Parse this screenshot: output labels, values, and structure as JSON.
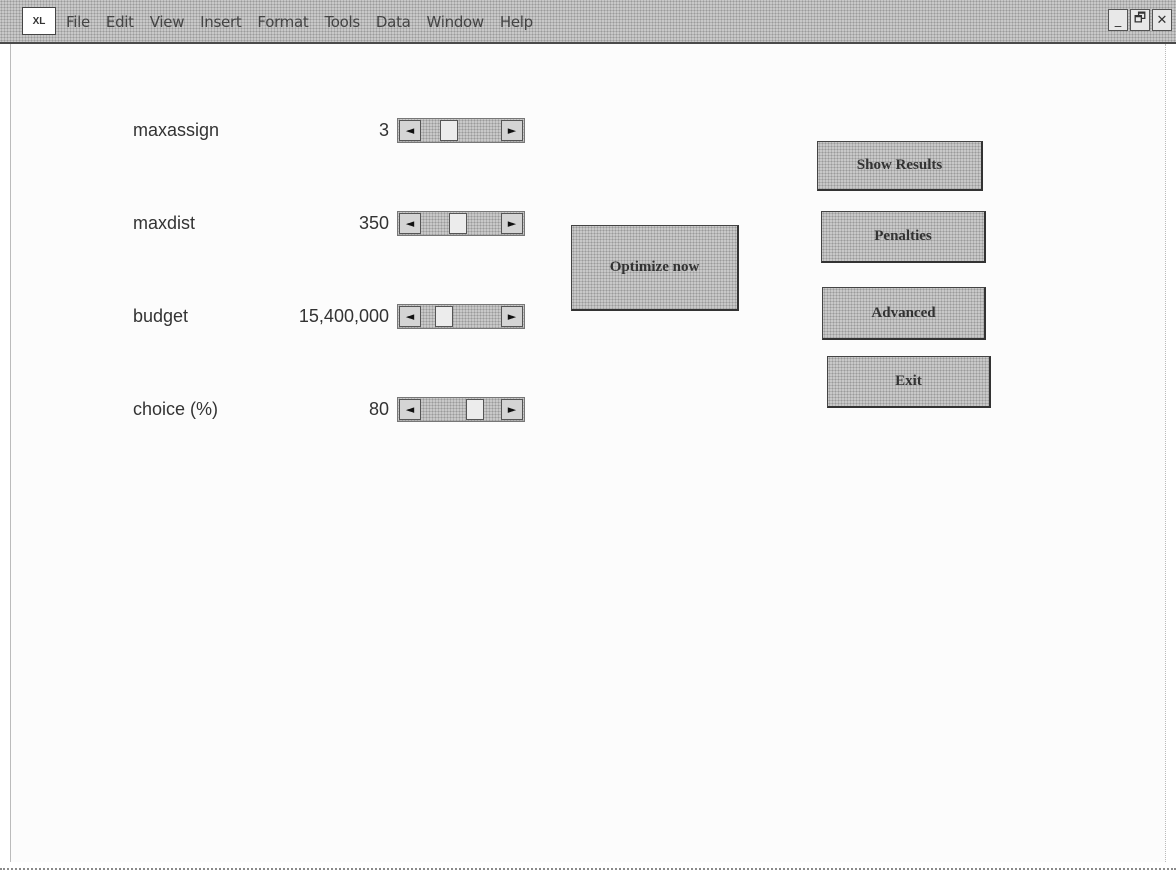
{
  "menubar": {
    "app_icon": "excel-app-icon",
    "app_icon_text": "XL",
    "items": [
      "File",
      "Edit",
      "View",
      "Insert",
      "Format",
      "Tools",
      "Data",
      "Window",
      "Help"
    ],
    "controls": {
      "minimize": "_",
      "restore": "🗗",
      "close": "✕"
    }
  },
  "parameters": [
    {
      "label": "maxassign",
      "value": "3",
      "scroll_position": 0.3
    },
    {
      "label": "maxdist",
      "value": "350",
      "scroll_position": 0.45
    },
    {
      "label": "budget",
      "value": "15,400,000",
      "scroll_position": 0.22
    },
    {
      "label": "choice (%)",
      "value": "80",
      "scroll_position": 0.72
    }
  ],
  "buttons": {
    "optimize": "Optimize now",
    "show_results": "Show Results",
    "penalties": "Penalties",
    "advanced": "Advanced",
    "exit": "Exit"
  },
  "scroll_arrows": {
    "left": "◄",
    "right": "►"
  }
}
